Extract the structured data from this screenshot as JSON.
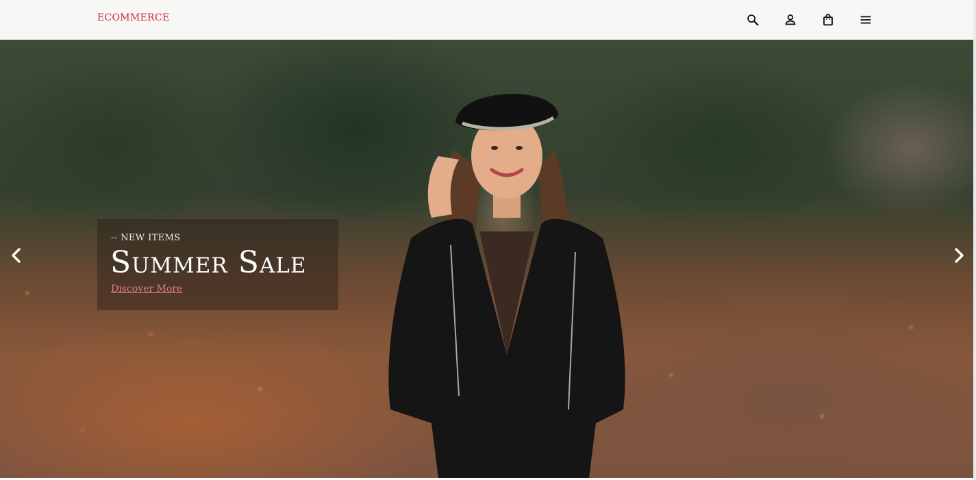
{
  "header": {
    "logo": "ECOMMERCE",
    "icons": [
      "search-icon",
      "user-icon",
      "shopping-bag-icon",
      "menu-icon"
    ]
  },
  "hero": {
    "eyebrow": "-- NEW ITEMS",
    "title": "Summer Sale",
    "link": "Discover More"
  },
  "colors": {
    "brand": "#d11f3b",
    "link": "#e07a90"
  }
}
